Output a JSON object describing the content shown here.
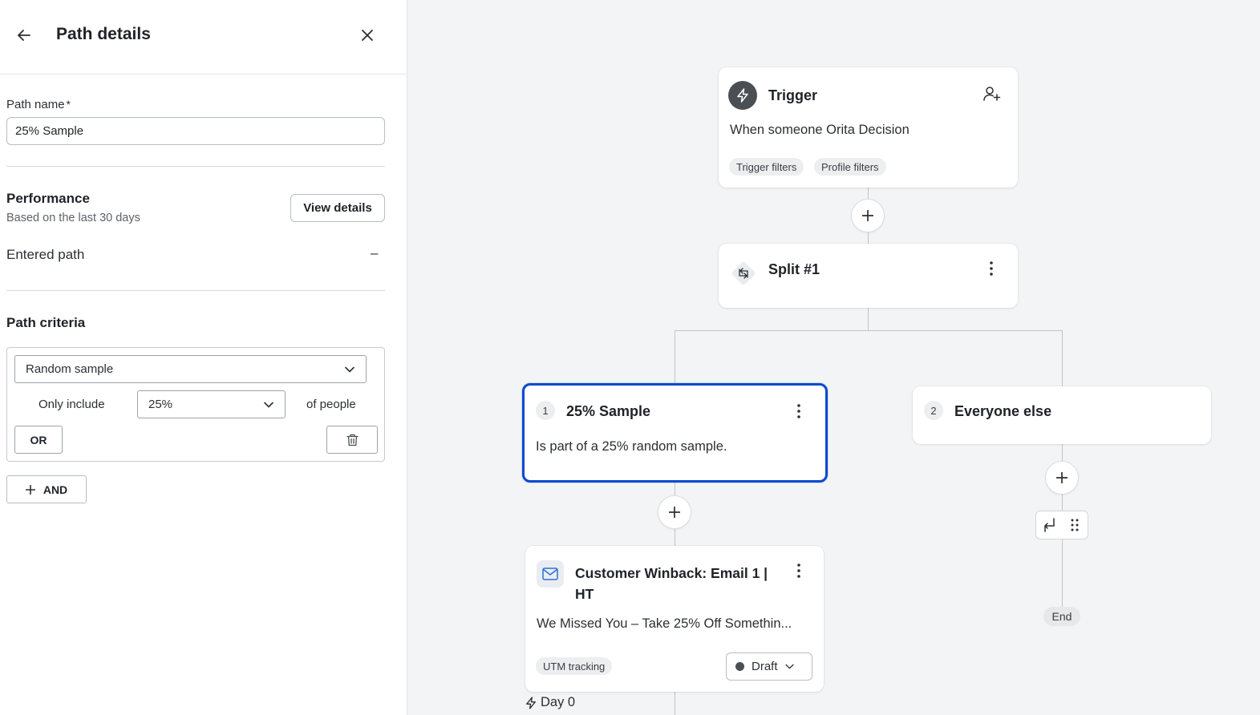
{
  "panel": {
    "title": "Path details",
    "path_name_label": "Path name",
    "required_mark": "*",
    "path_name_value": "25% Sample",
    "performance": {
      "title": "Performance",
      "subtitle": "Based on the last 30 days",
      "view_details": "View details",
      "entered_label": "Entered path",
      "entered_value": "–"
    },
    "criteria": {
      "title": "Path criteria",
      "type_selected": "Random sample",
      "only_include": "Only include",
      "percent_selected": "25%",
      "of_people": "of people",
      "or_label": "OR",
      "and_label": "AND"
    }
  },
  "flow": {
    "trigger": {
      "title": "Trigger",
      "description": "When someone Orita Decision",
      "chips": [
        "Trigger filters",
        "Profile filters"
      ]
    },
    "split": {
      "title": "Split #1"
    },
    "branches": [
      {
        "number": "1",
        "title": "25% Sample",
        "description": "Is part of a 25% random sample."
      },
      {
        "number": "2",
        "title": "Everyone else"
      }
    ],
    "email": {
      "title_line1": "Customer Winback: Email 1 |",
      "title_line2": "HT",
      "subject": "We Missed You – Take 25% Off Somethin...",
      "chip": "UTM tracking",
      "status": "Draft"
    },
    "day_label": "Day 0",
    "end_label": "End"
  },
  "icons": [
    "back-arrow-icon",
    "close-icon",
    "chevron-down-icon",
    "trash-icon",
    "plus-icon",
    "lightning-icon",
    "add-user-icon",
    "split-icon",
    "kebab-icon",
    "mail-icon",
    "branch-icon",
    "drag-handle-icon"
  ],
  "colors": {
    "selected_border": "#0a49d0",
    "canvas_bg": "#f2f4f5",
    "connector": "#c1c5c9"
  }
}
